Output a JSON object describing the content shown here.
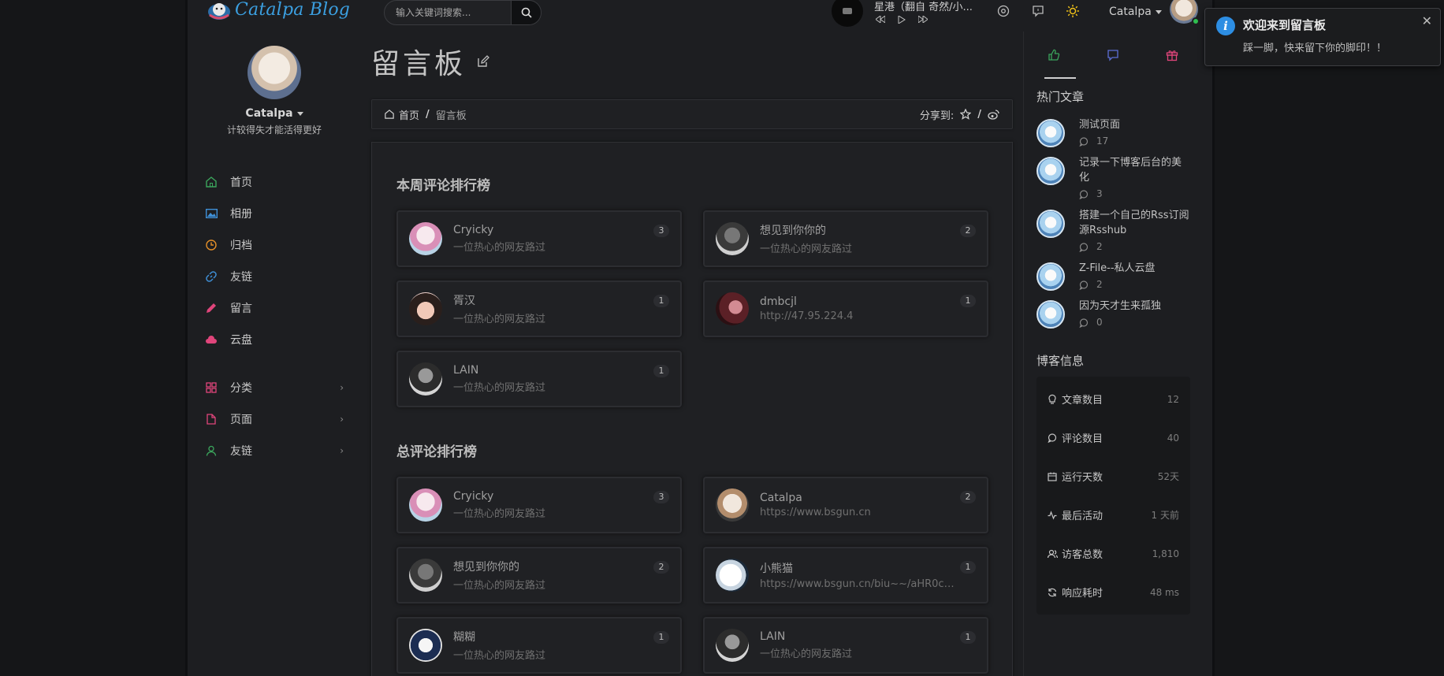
{
  "header": {
    "logo_text": "Catalpa Blog",
    "search_placeholder": "输入关键词搜索...",
    "player_song": "星港（翻自 奇然/小...",
    "user_name": "Catalpa"
  },
  "sidebar": {
    "user_name": "Catalpa",
    "motto": "计较得失才能活得更好",
    "items": [
      {
        "label": "首页",
        "icon": "home-icon",
        "color": "#3ba55c"
      },
      {
        "label": "相册",
        "icon": "image-icon",
        "color": "#3f8fd6"
      },
      {
        "label": "归档",
        "icon": "clock-icon",
        "color": "#e58f28"
      },
      {
        "label": "友链",
        "icon": "link-icon",
        "color": "#3f8fd6"
      },
      {
        "label": "留言",
        "icon": "pencil-icon",
        "color": "#e0457b"
      },
      {
        "label": "云盘",
        "icon": "cloud-icon",
        "color": "#e0457b"
      }
    ],
    "groups": [
      {
        "label": "分类",
        "icon": "grid-icon",
        "color": "#e0457b"
      },
      {
        "label": "页面",
        "icon": "file-icon",
        "color": "#e0457b"
      },
      {
        "label": "友链",
        "icon": "user-icon",
        "color": "#3ba55c"
      }
    ]
  },
  "main": {
    "page_title": "留言板",
    "breadcrumb": {
      "home": "首页",
      "current": "留言板",
      "share_label": "分享到:"
    },
    "weekly_title": "本周评论排行榜",
    "weekly": [
      {
        "name": "Cryicky",
        "desc": "一位热心的网友路过",
        "count": "3"
      },
      {
        "name": "想见到你你的",
        "desc": "一位热心的网友路过",
        "count": "2"
      },
      {
        "name": "胥汉",
        "desc": "一位热心的网友路过",
        "count": "1"
      },
      {
        "name": "dmbcjl",
        "desc": "http://47.95.224.4",
        "count": "1"
      },
      {
        "name": "LAIN",
        "desc": "一位热心的网友路过",
        "count": "1"
      }
    ],
    "total_title": "总评论排行榜",
    "total": [
      {
        "name": "Cryicky",
        "desc": "一位热心的网友路过",
        "count": "3"
      },
      {
        "name": "Catalpa",
        "desc": "https://www.bsgun.cn",
        "count": "2"
      },
      {
        "name": "想见到你你的",
        "desc": "一位热心的网友路过",
        "count": "2"
      },
      {
        "name": "小熊猫",
        "desc": "https://www.bsgun.cn/biu~~/aHR0cH...",
        "count": "1"
      },
      {
        "name": "糊糊",
        "desc": "一位热心的网友路过",
        "count": "1"
      },
      {
        "name": "LAIN",
        "desc": "一位热心的网友路过",
        "count": "1"
      }
    ]
  },
  "right": {
    "hot_title": "热门文章",
    "hot": [
      {
        "title": "测试页面",
        "comments": "17"
      },
      {
        "title": "记录一下博客后台的美化",
        "comments": "3"
      },
      {
        "title": "搭建一个自己的Rss订阅源Rsshub",
        "comments": "2"
      },
      {
        "title": "Z-File--私人云盘",
        "comments": "2"
      },
      {
        "title": "因为天才生来孤独",
        "comments": "0"
      }
    ],
    "info_title": "博客信息",
    "info": [
      {
        "label": "文章数目",
        "value": "12",
        "icon": "bulb-icon"
      },
      {
        "label": "评论数目",
        "value": "40",
        "icon": "comment-icon"
      },
      {
        "label": "运行天数",
        "value": "52天",
        "icon": "calendar-icon"
      },
      {
        "label": "最后活动",
        "value": "1 天前",
        "icon": "activity-icon"
      },
      {
        "label": "访客总数",
        "value": "1,810",
        "icon": "users-icon"
      },
      {
        "label": "响应耗时",
        "value": "48 ms",
        "icon": "refresh-icon"
      }
    ]
  },
  "toast": {
    "title": "欢迎来到留言板",
    "message": "踩一脚，快来留下你的脚印！！"
  }
}
